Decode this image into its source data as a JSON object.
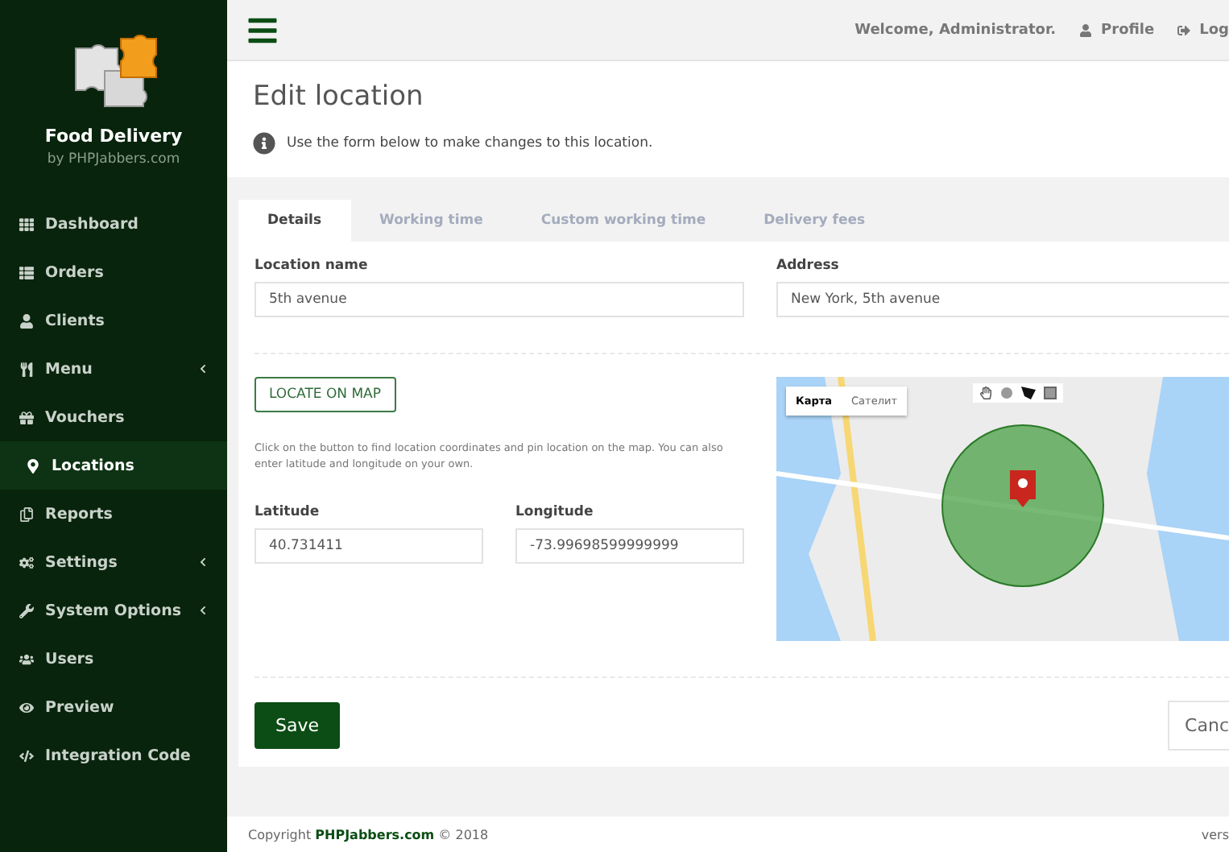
{
  "sidebar": {
    "app_title": "Food Delivery",
    "app_subtitle": "by PHPJabbers.com",
    "items": [
      {
        "label": "Dashboard",
        "selected": false,
        "has_submenu": false
      },
      {
        "label": "Orders",
        "selected": false,
        "has_submenu": false
      },
      {
        "label": "Clients",
        "selected": false,
        "has_submenu": false
      },
      {
        "label": "Menu",
        "selected": false,
        "has_submenu": true
      },
      {
        "label": "Vouchers",
        "selected": false,
        "has_submenu": false
      },
      {
        "label": "Locations",
        "selected": true,
        "has_submenu": false
      },
      {
        "label": "Reports",
        "selected": false,
        "has_submenu": false
      },
      {
        "label": "Settings",
        "selected": false,
        "has_submenu": true
      },
      {
        "label": "System Options",
        "selected": false,
        "has_submenu": true
      },
      {
        "label": "Users",
        "selected": false,
        "has_submenu": false
      },
      {
        "label": "Preview",
        "selected": false,
        "has_submenu": false
      },
      {
        "label": "Integration Code",
        "selected": false,
        "has_submenu": false
      }
    ]
  },
  "top_bar": {
    "welcome": "Welcome, Administrator.",
    "profile": "Profile",
    "logout": "Log"
  },
  "header": {
    "title": "Edit location",
    "info": "Use the form below to make changes to this location."
  },
  "tabs": [
    {
      "label": "Details",
      "selected": true
    },
    {
      "label": "Working time",
      "selected": false
    },
    {
      "label": "Custom working time",
      "selected": false
    },
    {
      "label": "Delivery fees",
      "selected": false
    }
  ],
  "form": {
    "location_name": {
      "label": "Location name",
      "value": "5th avenue"
    },
    "address": {
      "label": "Address",
      "value": "New York, 5th avenue"
    },
    "locate_button": "LOCATE ON MAP",
    "help": "Click on the button to find location coordinates and pin location on the map. You can also enter latitude and longitude on your own.",
    "latitude": {
      "label": "Latitude",
      "value": "40.731411"
    },
    "longitude": {
      "label": "Longitude",
      "value": "-73.99698599999999"
    },
    "map": {
      "map_types": [
        {
          "label": "Карта",
          "selected": true
        },
        {
          "label": "Сателит",
          "selected": false
        }
      ]
    },
    "save": "Save",
    "cancel": "Canc"
  },
  "footer": {
    "copyright": "Copyright **PHPJabbers.com** © 2018",
    "version": "vers"
  }
}
